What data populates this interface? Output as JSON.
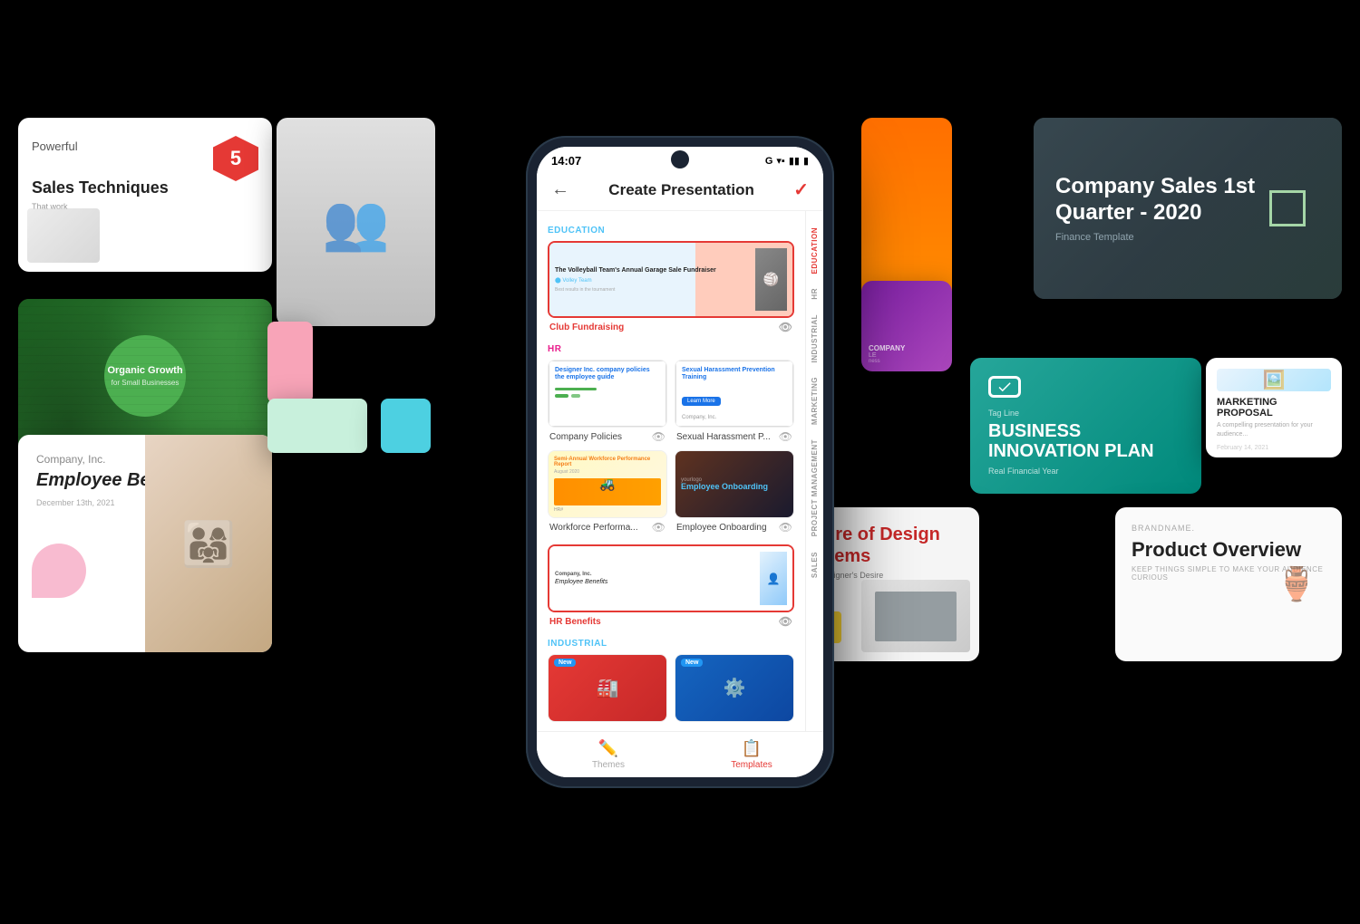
{
  "app": {
    "title": "Create Presentation"
  },
  "phone": {
    "status_time": "14:07",
    "google_logo": "G",
    "back_arrow": "←",
    "check_mark": "✓",
    "bottom_nav": {
      "themes_label": "Themes",
      "templates_label": "Templates"
    }
  },
  "sections": {
    "education_label": "EDUCATION",
    "hr_label": "HR",
    "industrial_label": "INDUSTRIAL"
  },
  "side_tabs": [
    "EDUCATION",
    "HR",
    "INDUSTRIAL",
    "MARKETING",
    "PROJECT MANAGEMENT",
    "SALES"
  ],
  "templates": {
    "club_fundraising": "Club Fundraising",
    "company_policies": "Company Policies",
    "sexual_harassment": "Sexual Harassment P...",
    "workforce": "Workforce Performa...",
    "employee_onboarding": "Employee Onboarding",
    "hr_benefits": "HR Benefits"
  },
  "bg_cards": {
    "sales_techniques": {
      "number": "5",
      "title": "Sales Techniques",
      "subtitle": "Powerful",
      "tagline": "That work"
    },
    "organic_growth": {
      "title": "Organic Growth",
      "subtitle": "for Small Businesses"
    },
    "employee_benefits": {
      "company": "Company, Inc.",
      "title": "Employee Benefits",
      "date": "December 13th, 2021"
    },
    "company_sales": {
      "title": "Company Sales 1st Quarter - 2020",
      "subtitle": "Finance Template"
    },
    "business_innovation": {
      "tagline": "Tag Line",
      "title": "BUSINESS INNOVATION PLAN",
      "subtitle": "Real Financial Year"
    },
    "marketing_proposal": {
      "title": "MARKETING PROPOSAL",
      "date": "February 14, 2021"
    },
    "future_design": {
      "title": "Future of Design Systems",
      "subtitle": "Every Designer's Desire"
    },
    "product_overview": {
      "brand": "brandname.",
      "title": "Product Overview",
      "subtitle": "KEEP THINGS SIMPLE TO MAKE YOUR AUDIENCE CURIOUS"
    }
  },
  "colors": {
    "accent_red": "#e53935",
    "accent_blue": "#4FC3F7",
    "accent_teal": "#26a69a",
    "bg_dark": "#1a2332"
  }
}
